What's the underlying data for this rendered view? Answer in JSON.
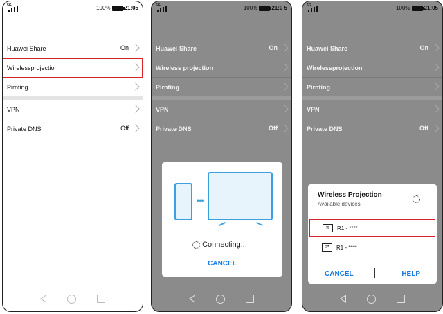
{
  "status": {
    "network": "5G",
    "battery": "100%",
    "time_1": "21:05",
    "time_2": "21:0 5",
    "time_3": "21:05"
  },
  "settings": [
    {
      "label": "Huawei Share",
      "value": "On"
    },
    {
      "label": "Wirelessprojection",
      "value": ""
    },
    {
      "label": "Pirnting",
      "value": ""
    },
    {
      "label": "VPN",
      "value": ""
    },
    {
      "label": "Private DNS",
      "value": "Off"
    }
  ],
  "settings_2_label": "Wireless projection",
  "connecting_dialog": {
    "status": "Connecting...",
    "cancel": "CANCEL"
  },
  "device_dialog": {
    "title": "Wireless Projection",
    "subtitle": "Available devices",
    "devices": [
      "R1 - ****",
      "R1 - ****"
    ],
    "cancel": "CANCEL",
    "help": "HELP"
  },
  "colors": {
    "highlight": "#d6232a",
    "accent": "#1a7be0",
    "illustration": "#3aa0e0"
  }
}
